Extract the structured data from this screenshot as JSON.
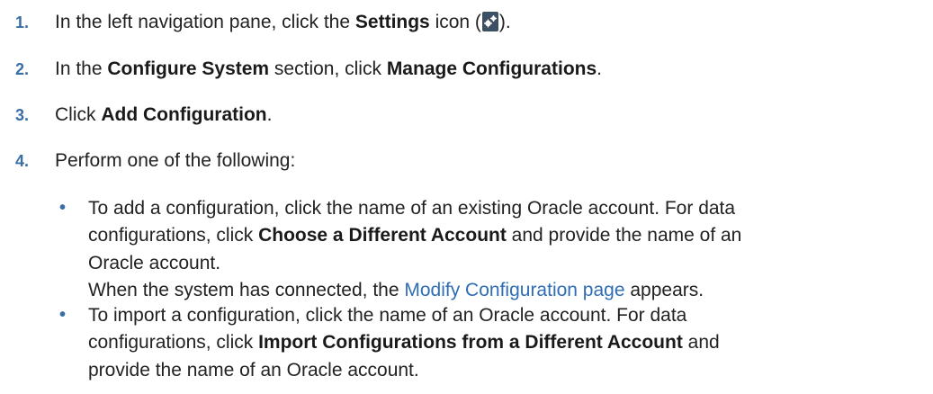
{
  "steps": [
    {
      "number": "1.",
      "pre": "In the left navigation pane, click the ",
      "bold": "Settings",
      "mid": " icon (",
      "post": ")."
    },
    {
      "number": "2.",
      "pre": "In the ",
      "bold1": "Configure System",
      "mid": " section, click ",
      "bold2": "Manage Configurations",
      "post": "."
    },
    {
      "number": "3.",
      "pre": "Click ",
      "bold": "Add Configuration",
      "post": "."
    },
    {
      "number": "4.",
      "text": "Perform one of the following:"
    }
  ],
  "options": [
    {
      "line1": "To add a configuration, click the name of an existing Oracle account. For data",
      "line2_pre": "configurations, click ",
      "line2_bold": "Choose a Different Account",
      "line2_post": " and provide the name of an",
      "line3": "Oracle account.",
      "line4_pre": "When the system has connected, the ",
      "line4_link": "Modify Configuration page",
      "line4_post": " appears."
    },
    {
      "line1": "To import a configuration, click the name of an Oracle account. For data",
      "line2_pre": "configurations, click ",
      "line2_bold": "Import Configurations from a Different Account",
      "line2_post": " and",
      "line3": "provide the name of an Oracle account."
    }
  ],
  "icons": {
    "settings": "settings-gear-icon"
  },
  "colors": {
    "step_number": "#3a6ea5",
    "link": "#2f6db5",
    "text": "#222222",
    "icon_bg": "#3d4f62"
  }
}
